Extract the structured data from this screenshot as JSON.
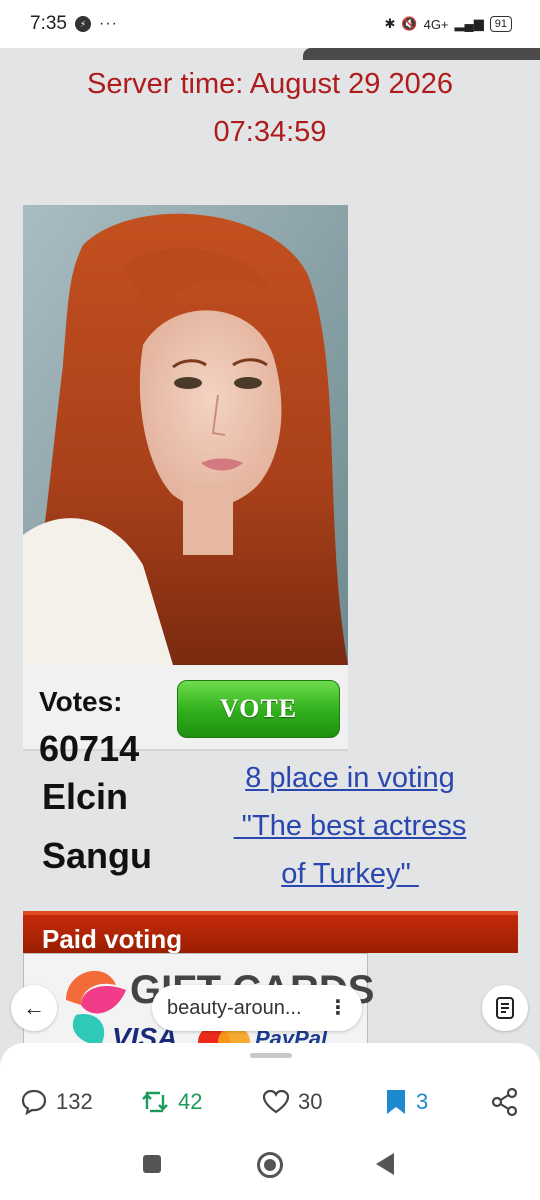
{
  "status_bar": {
    "time": "7:35",
    "network": "4G+",
    "battery": "91"
  },
  "page": {
    "server_time_line1": "Server time: August 29 2026",
    "server_time_line2": "07:34:59",
    "votes_label": "Votes:",
    "votes_count": "60714",
    "vote_button": "VOTE",
    "name_first": "Elcin",
    "name_last": "Sangu",
    "place_line1": "8 place in voting",
    "place_line2": " \"The best actress",
    "place_line3": "of Turkey\" ",
    "paid_voting": "Paid voting",
    "gift_cards": "GIFT CARDS",
    "visa": "VISA",
    "paypal": "PayPal"
  },
  "browser": {
    "url": "beauty-aroun..."
  },
  "actions": {
    "comments": "132",
    "retweets": "42",
    "likes": "30",
    "bookmarks": "3"
  },
  "colors": {
    "server_time": "#b01c1c",
    "link": "#2a47b0",
    "paid_bar": "#a82200",
    "vote_green": "#2fae1c"
  }
}
